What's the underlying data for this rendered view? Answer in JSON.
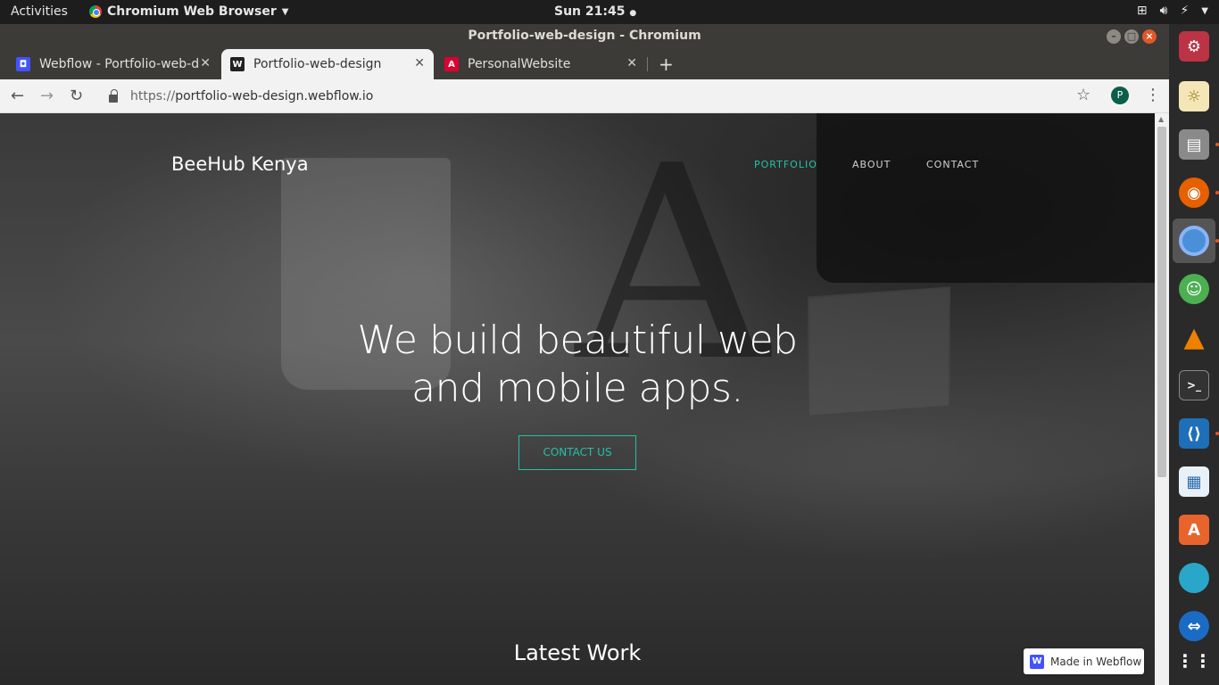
{
  "topbar": {
    "activities": "Activities",
    "app_menu": "Chromium Web Browser",
    "clock": "Sun 21:45"
  },
  "window": {
    "title": "Portfolio-web-design - Chromium"
  },
  "tabs": [
    {
      "label": "Webflow - Portfolio-web-d",
      "favicon": "webflow-icon",
      "color": "#4353ff"
    },
    {
      "label": "Portfolio-web-design",
      "favicon": "w-icon",
      "color": "#222222"
    },
    {
      "label": "PersonalWebsite",
      "favicon": "angular-icon",
      "color": "#dd0031"
    }
  ],
  "toolbar": {
    "url_prefix": "https://",
    "url_host": "portfolio-web-design.webflow.io",
    "profile_initial": "P"
  },
  "page": {
    "brand": "BeeHub Kenya",
    "nav": [
      "PORTFOLIO",
      "ABOUT",
      "CONTACT"
    ],
    "hero_line1": "We build beautiful web",
    "hero_line2": "and mobile apps.",
    "cta": "CONTACT US",
    "section_title": "Latest Work",
    "badge": "Made in Webflow",
    "accent": "#23c0a9"
  },
  "dock": [
    "settings-icon",
    "brightness-icon",
    "files-icon",
    "firefox-icon",
    "chromium-icon",
    "world-icon",
    "vlc-icon",
    "terminal-icon",
    "vscode-icon",
    "writer-icon",
    "software-center-icon",
    "globe-icon",
    "teamviewer-icon",
    "apps-grid-icon"
  ]
}
